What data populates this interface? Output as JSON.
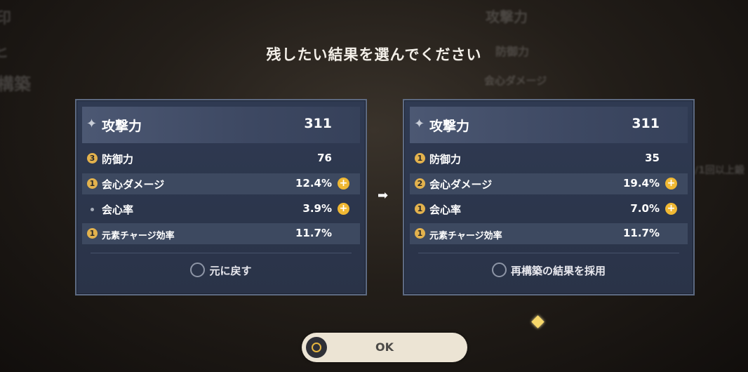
{
  "background": {
    "left_texts": [
      "印",
      "ヒ",
      "構築"
    ],
    "right_texts": [
      "攻撃力",
      "防御力",
      "会心ダメージ",
      "/1回以上鍛"
    ]
  },
  "title": "残したい結果を選んでください",
  "cards": [
    {
      "main_stat": {
        "name": "攻撃力",
        "value": "311"
      },
      "sub_stats": [
        {
          "badge": "3",
          "name": "防御力",
          "value": "76",
          "plus": false
        },
        {
          "badge": "1",
          "name": "会心ダメージ",
          "value": "12.4%",
          "plus": true
        },
        {
          "badge": "",
          "name": "会心率",
          "value": "3.9%",
          "plus": true
        },
        {
          "badge": "1",
          "name": "元素チャージ効率",
          "value": "11.7%",
          "plus": false
        }
      ],
      "choice_label": "元に戻す"
    },
    {
      "main_stat": {
        "name": "攻撃力",
        "value": "311"
      },
      "sub_stats": [
        {
          "badge": "1",
          "name": "防御力",
          "value": "35",
          "plus": false
        },
        {
          "badge": "2",
          "name": "会心ダメージ",
          "value": "19.4%",
          "plus": true
        },
        {
          "badge": "1",
          "name": "会心率",
          "value": "7.0%",
          "plus": true
        },
        {
          "badge": "1",
          "name": "元素チャージ効率",
          "value": "11.7%",
          "plus": false
        }
      ],
      "choice_label": "再構築の結果を採用"
    }
  ],
  "ok_button": {
    "label": "OK"
  },
  "icons": {
    "star": "✦",
    "arrow": "➡",
    "plus": "+"
  },
  "colors": {
    "badge": "#e3b24d",
    "plus_badge": "#f0b833",
    "panel": "#2f3a52"
  }
}
